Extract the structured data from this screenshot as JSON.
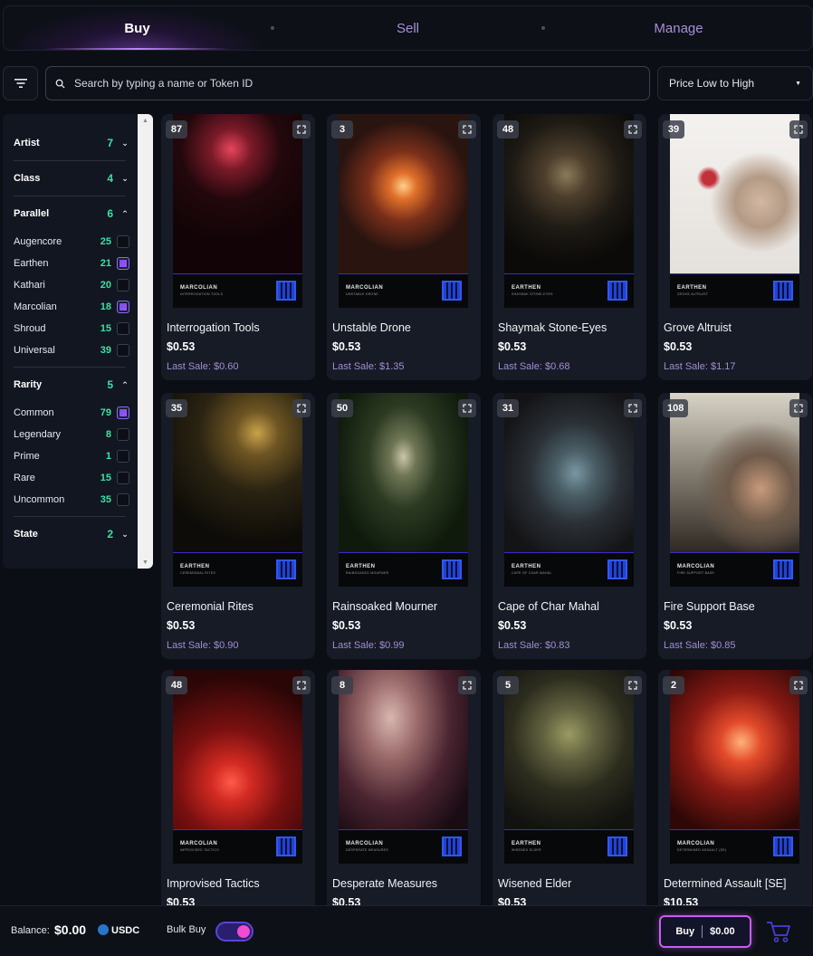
{
  "tabs": [
    {
      "label": "Buy",
      "active": true
    },
    {
      "label": "Sell",
      "active": false
    },
    {
      "label": "Manage",
      "active": false
    }
  ],
  "search": {
    "placeholder": "Search by typing a name or Token ID"
  },
  "sort": {
    "selected": "Price Low to High"
  },
  "filters": {
    "artist": {
      "label": "Artist",
      "count": "7",
      "expanded": false
    },
    "class": {
      "label": "Class",
      "count": "4",
      "expanded": false
    },
    "parallel": {
      "label": "Parallel",
      "count": "6",
      "expanded": true,
      "options": [
        {
          "label": "Augencore",
          "count": "25",
          "checked": false
        },
        {
          "label": "Earthen",
          "count": "21",
          "checked": true
        },
        {
          "label": "Kathari",
          "count": "20",
          "checked": false
        },
        {
          "label": "Marcolian",
          "count": "18",
          "checked": true
        },
        {
          "label": "Shroud",
          "count": "15",
          "checked": false
        },
        {
          "label": "Universal",
          "count": "39",
          "checked": false
        }
      ]
    },
    "rarity": {
      "label": "Rarity",
      "count": "5",
      "expanded": true,
      "options": [
        {
          "label": "Common",
          "count": "79",
          "checked": true
        },
        {
          "label": "Legendary",
          "count": "8",
          "checked": false
        },
        {
          "label": "Prime",
          "count": "1",
          "checked": false
        },
        {
          "label": "Rare",
          "count": "15",
          "checked": false
        },
        {
          "label": "Uncommon",
          "count": "35",
          "checked": false
        }
      ]
    },
    "state": {
      "label": "State",
      "count": "2",
      "expanded": false
    }
  },
  "cards": [
    {
      "qty": "87",
      "name": "Interrogation Tools",
      "price": "$0.53",
      "last_sale": "Last Sale: $0.60",
      "parallel": "MARCOLIAN",
      "sub": "INTERROGATION TOOLS",
      "bg": "radial-gradient(circle at 45% 22%, #e8455a 0%, #7a1a28 14%, #22080c 35%, #120406 65%), linear-gradient(180deg, #1b0508, #2a070c)"
    },
    {
      "qty": "3",
      "name": "Unstable Drone",
      "price": "$0.53",
      "last_sale": "Last Sale: $1.35",
      "parallel": "MARCOLIAN",
      "sub": "UNSTABLE DRONE",
      "bg": "radial-gradient(circle at 50% 45%, #ffd08a 0%, #e0702a 12%, #7a2f1a 32%, #2a1410 60%), linear-gradient(180deg, #3a2218, #150a08)"
    },
    {
      "qty": "48",
      "name": "Shaymak Stone-Eyes",
      "price": "$0.53",
      "last_sale": "Last Sale: $0.68",
      "parallel": "EARTHEN",
      "sub": "SHAYMAK STONE-EYES",
      "bg": "radial-gradient(circle at 48% 38%, #8a7a5a 0%, #4d3f2c 18%, #1e1a14 45%, #0b0a08 75%)"
    },
    {
      "qty": "39",
      "name": "Grove Altruist",
      "price": "$0.53",
      "last_sale": "Last Sale: $1.17",
      "parallel": "EARTHEN",
      "sub": "GROVE ALTRUIST",
      "bg": "radial-gradient(circle at 30% 40%, #c2303a 0%, #c2303a 5%, rgba(0,0,0,0) 9%), radial-gradient(circle at 70% 55%, #d2b8a2 0%, #b39a86 20%, rgba(0,0,0,0) 40%), linear-gradient(180deg, #f4f2ef, #e4e0dc)"
    },
    {
      "qty": "35",
      "name": "Ceremonial Rites",
      "price": "$0.53",
      "last_sale": "Last Sale: $0.90",
      "parallel": "EARTHEN",
      "sub": "CEREMONIAL RITES",
      "bg": "radial-gradient(circle at 65% 25%, #c9a24a 0%, #6e5523 15%, #2a2312 40%, #0e0c08 75%)"
    },
    {
      "qty": "50",
      "name": "Rainsoaked Mourner",
      "price": "$0.53",
      "last_sale": "Last Sale: $0.99",
      "parallel": "EARTHEN",
      "sub": "RAINSOAKED MOURNER",
      "bg": "radial-gradient(ellipse at 50% 40%, #c9c7a8 0%, #6f7656 14%, #2c3a22 38%, #0f1a0c 75%)"
    },
    {
      "qty": "31",
      "name": "Cape of Char Mahal",
      "price": "$0.53",
      "last_sale": "Last Sale: $0.83",
      "parallel": "EARTHEN",
      "sub": "CAPE OF CHAR MAHAL",
      "bg": "radial-gradient(ellipse at 55% 50%, #7a96a2 0%, #4a5e66 20%, #2a3036 45%, #141416 80%), linear-gradient(90deg, #3a2a22, #1a1e24)"
    },
    {
      "qty": "108",
      "name": "Fire Support Base",
      "price": "$0.53",
      "last_sale": "Last Sale: $0.85",
      "parallel": "MARCOLIAN",
      "sub": "FIRE SUPPORT BASE",
      "bg": "radial-gradient(ellipse at 70% 60%, #c89a7a 0%, #6e5a4a 25%, rgba(0,0,0,0) 50%), linear-gradient(180deg, #d9d4c8 0%, #8a8478 45%, #2e2822 100%)"
    },
    {
      "qty": "48",
      "name": "Improvised Tactics",
      "price": "$0.53",
      "last_sale": "",
      "parallel": "MARCOLIAN",
      "sub": "IMPROVISED TACTICS",
      "bg": "radial-gradient(circle at 45% 70%, #ff5a4a 0%, #d22a22 15%, #7a1010 40%, #2a0606 80%), linear-gradient(180deg, #5a0c0c, #1a0404)"
    },
    {
      "qty": "8",
      "name": "Desperate Measures",
      "price": "$0.53",
      "last_sale": "",
      "parallel": "MARCOLIAN",
      "sub": "DESPERATE MEASURES",
      "bg": "radial-gradient(ellipse at 40% 30%, #d8b6b0 0%, #9a6a6a 25%, #4a2430 55%, #1a0c14 85%), linear-gradient(180deg, #c89a98, #2a1018)"
    },
    {
      "qty": "5",
      "name": "Wisened Elder",
      "price": "$0.53",
      "last_sale": "",
      "parallel": "EARTHEN",
      "sub": "WISENED ELDER",
      "bg": "radial-gradient(circle at 50% 40%, #9a9a62 0%, #626240 22%, #2c2c1e 50%, #121210 85%)"
    },
    {
      "qty": "2",
      "name": "Determined Assault [SE]",
      "price": "$10.53",
      "last_sale": "",
      "parallel": "MARCOLIAN",
      "sub": "DETERMINED ASSAULT (SE)",
      "bg": "radial-gradient(circle at 55% 45%, #ffb27a 0%, #e24a2a 18%, #8a1a14 45%, #2e0806 85%)"
    }
  ],
  "footer": {
    "balance_label": "Balance:",
    "balance_value": "$0.00",
    "currency": "USDC",
    "bulk_label": "Bulk Buy",
    "bulk_on": true,
    "buy_label": "Buy",
    "buy_total": "$0.00"
  },
  "colors": {
    "accent": "#a855f7",
    "count": "#3ee0a5",
    "last_sale": "#a08fd0"
  }
}
